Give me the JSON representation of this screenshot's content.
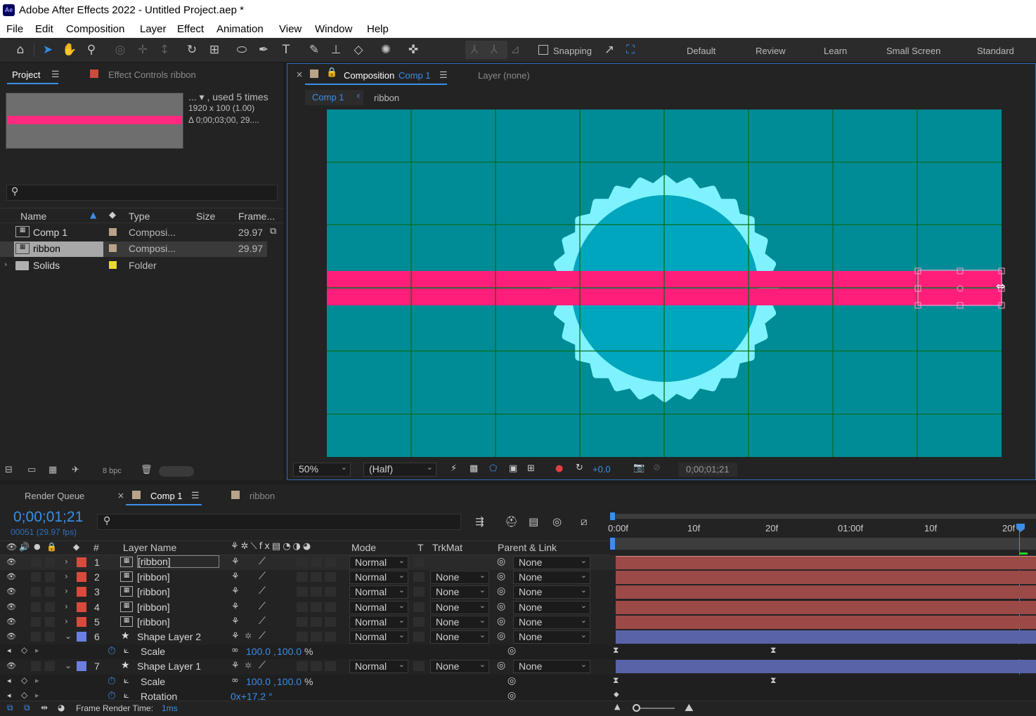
{
  "window": {
    "title": "Adobe After Effects 2022 - Untitled Project.aep *",
    "app_logo": "Ae"
  },
  "menu": [
    "File",
    "Edit",
    "Composition",
    "Layer",
    "Effect",
    "Animation",
    "View",
    "Window",
    "Help"
  ],
  "toolbar": {
    "snapping_label": "Snapping",
    "workspaces": [
      "Default",
      "Review",
      "Learn",
      "Small Screen",
      "Standard"
    ]
  },
  "project_panel": {
    "tab_project": "Project",
    "tab_effect_controls": "Effect Controls ribbon",
    "preview_info": {
      "used": "... ▾ , used 5 times",
      "dims": "1920 x 100 (1.00)",
      "duration": "Δ 0;00;03;00, 29...."
    },
    "search_placeholder": "",
    "columns": [
      "Name",
      "Type",
      "Size",
      "Frame..."
    ],
    "items": [
      {
        "name": "Comp 1",
        "type": "Composi...",
        "fps": "29.97"
      },
      {
        "name": "ribbon",
        "type": "Composi...",
        "fps": "29.97"
      },
      {
        "name": "Solids",
        "type": "Folder",
        "fps": ""
      }
    ],
    "bpc": "8 bpc"
  },
  "comp_panel": {
    "tab_composition": "Composition",
    "tab_comp_name": "Comp 1",
    "tab_layer": "Layer (none)",
    "breadcrumb_comp": "Comp 1",
    "breadcrumb_ribbon": "ribbon",
    "zoom": "50%",
    "resolution": "(Half)",
    "exposure": "+0.0",
    "timecode": "0;00;01;21",
    "colors": {
      "background": "#008c96",
      "badge": "#7ff2ff",
      "inner": "#00a6bd",
      "ribbon": "#ff1f7a",
      "grid": "#0a6b1c"
    }
  },
  "timeline": {
    "tab_render_queue": "Render Queue",
    "tab_comp1": "Comp 1",
    "tab_ribbon": "ribbon",
    "current_time": "0;00;01;21",
    "frame_info": "00051 (29.97 fps)",
    "search_placeholder": "",
    "columns": {
      "number": "#",
      "layer_name": "Layer Name",
      "mode": "Mode",
      "t": "T",
      "trkmat": "TrkMat",
      "parent": "Parent & Link"
    },
    "ruler": [
      "0:00f",
      "10f",
      "20f",
      "01:00f",
      "10f",
      "20f"
    ],
    "layers": [
      {
        "num": "1",
        "name": "[ribbon]",
        "mode": "Normal",
        "trkmat": "",
        "parent": "None",
        "color": "#d84b3c",
        "kind": "comp"
      },
      {
        "num": "2",
        "name": "[ribbon]",
        "mode": "Normal",
        "trkmat": "None",
        "parent": "None",
        "color": "#d84b3c",
        "kind": "comp"
      },
      {
        "num": "3",
        "name": "[ribbon]",
        "mode": "Normal",
        "trkmat": "None",
        "parent": "None",
        "color": "#d84b3c",
        "kind": "comp"
      },
      {
        "num": "4",
        "name": "[ribbon]",
        "mode": "Normal",
        "trkmat": "None",
        "parent": "None",
        "color": "#d84b3c",
        "kind": "comp"
      },
      {
        "num": "5",
        "name": "[ribbon]",
        "mode": "Normal",
        "trkmat": "None",
        "parent": "None",
        "color": "#d84b3c",
        "kind": "comp"
      },
      {
        "num": "6",
        "name": "Shape Layer 2",
        "mode": "Normal",
        "trkmat": "None",
        "parent": "None",
        "color": "#6b7fe0",
        "kind": "shape"
      },
      {
        "num": "7",
        "name": "Shape Layer 1",
        "mode": "Normal",
        "trkmat": "None",
        "parent": "None",
        "color": "#6b7fe0",
        "kind": "shape"
      }
    ],
    "props": {
      "scale_label": "Scale",
      "scale_x": "100.0",
      "scale_y": "100.0",
      "scale_unit": "%",
      "rotation_label": "Rotation",
      "rotation_value": "0x+17.2 °"
    },
    "footer": {
      "render_label": "Frame Render Time:",
      "render_value": "1ms"
    }
  }
}
